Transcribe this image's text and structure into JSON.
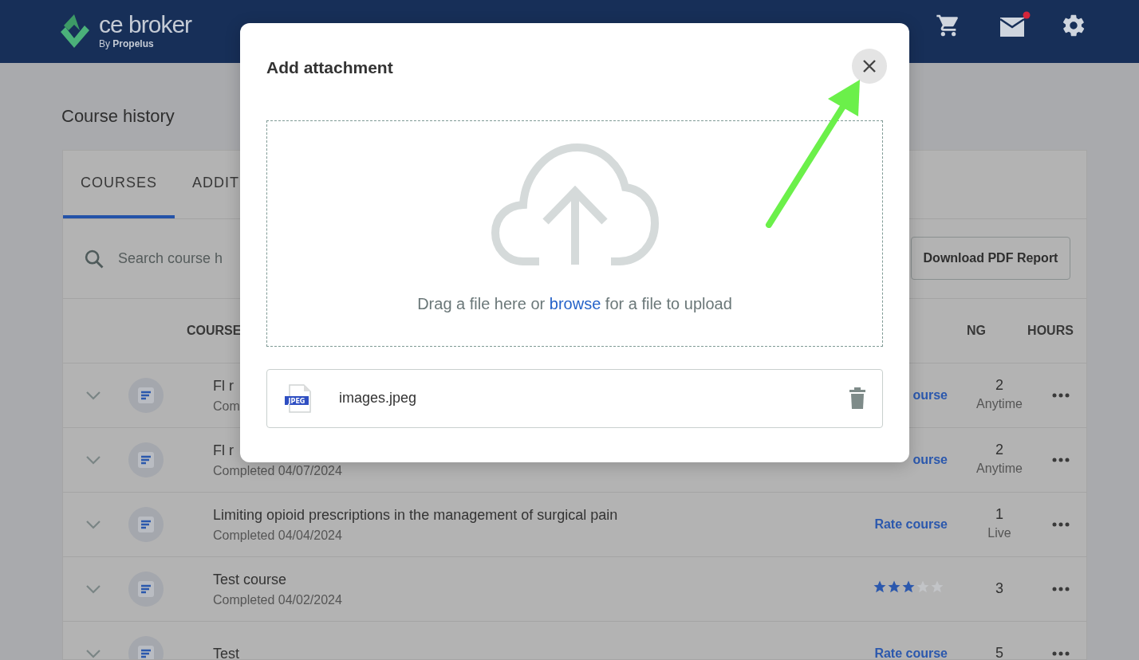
{
  "header": {
    "logo_text": "ce broker",
    "logo_sub": "By **Propelus**",
    "mail_unread": true
  },
  "page": {
    "title": "Course history"
  },
  "tabs": [
    {
      "label": "COURSES",
      "selected": true
    },
    {
      "label": "ADDIT",
      "selected": false
    }
  ],
  "search": {
    "placeholder": "Search course h"
  },
  "report_button": "Download PDF Report",
  "columns": [
    "COURSE",
    "NG",
    "HOURS"
  ],
  "rows": [
    {
      "title": "Fl r",
      "subtitle": "Com",
      "rating": {
        "kind": "rate",
        "text": "ourse"
      },
      "hours": "2",
      "mode": "Anytime"
    },
    {
      "title": "Fl r",
      "subtitle": "Completed 04/07/2024",
      "rating": {
        "kind": "rate",
        "text": "ourse"
      },
      "hours": "2",
      "mode": "Anytime"
    },
    {
      "title": "Limiting opioid prescriptions in the management of surgical pain",
      "subtitle": "Completed 04/04/2024",
      "rating": {
        "kind": "rate",
        "text": "Rate course"
      },
      "hours": "1",
      "mode": "Live"
    },
    {
      "title": "Test course",
      "subtitle": "Completed 04/02/2024",
      "rating": {
        "kind": "stars",
        "stars": 3
      },
      "hours": "3",
      "mode": ""
    },
    {
      "title": "Test",
      "subtitle": "",
      "rating": {
        "kind": "rate",
        "text": "Rate course"
      },
      "hours": "5",
      "mode": ""
    }
  ],
  "modal": {
    "title": "Add attachment",
    "drop_text": "Drag a file here or ",
    "browse_link": "browse",
    "drop_text_after": " for a file to upload",
    "file": {
      "badge": "JPEG",
      "name": "images.jpeg"
    }
  }
}
